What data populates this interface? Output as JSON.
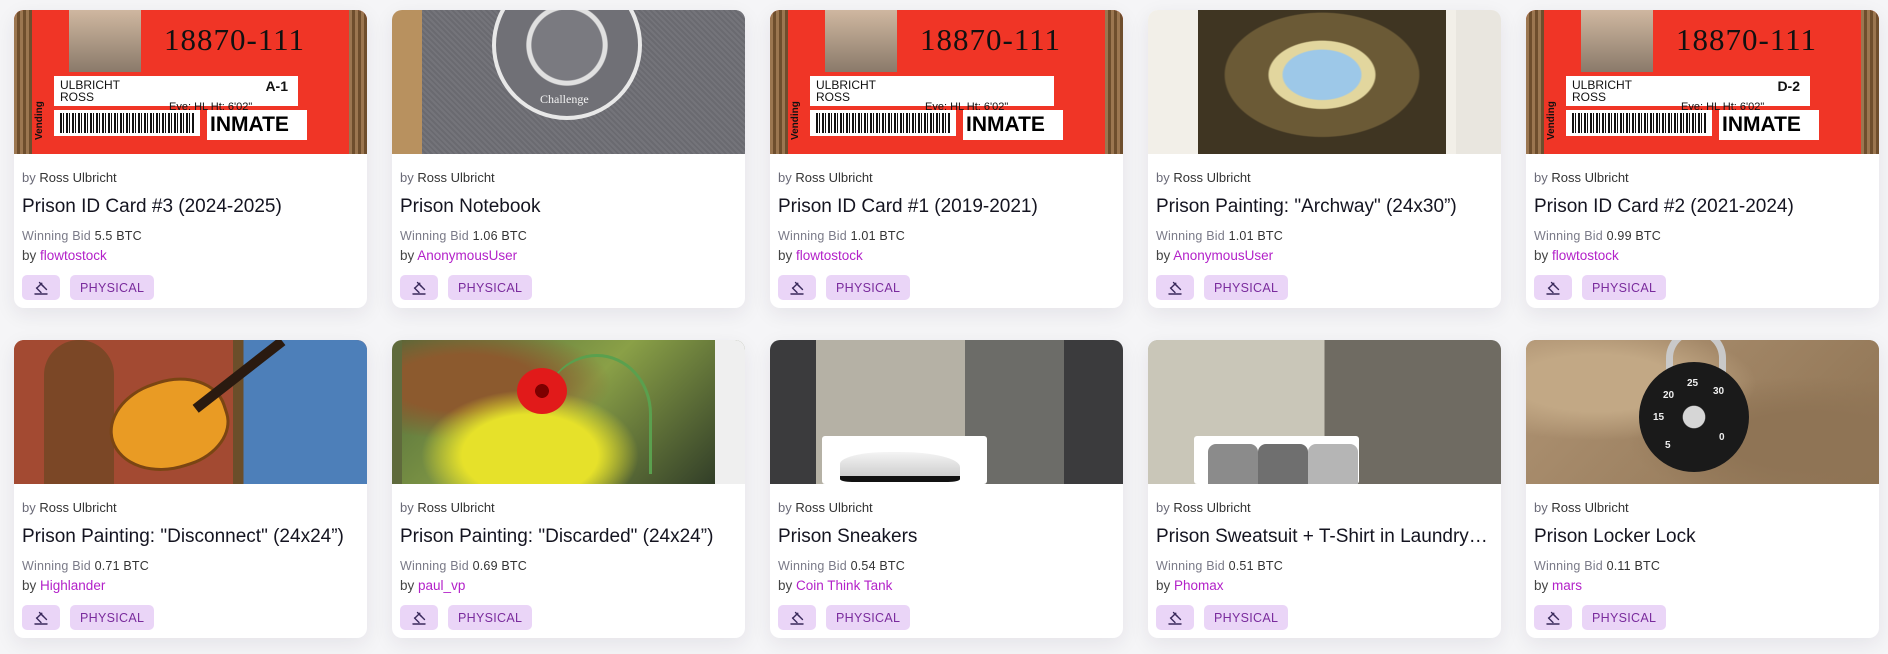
{
  "labels": {
    "by": "by",
    "winning_bid": "Winning Bid",
    "tag": "PHYSICAL"
  },
  "cards": [
    {
      "artist": "Ross Ulbricht",
      "title": "Prison ID Card #3 (2024-2025)",
      "bid": "5.5 BTC",
      "buyer": "flowtostock",
      "thumb": "id-card",
      "id_card": {
        "number": "18870-111",
        "name1": "ULBRICHT",
        "name2": "ROSS",
        "code": "A-1",
        "eye": "Eye: HL    Ht: 6'02\"",
        "inmate": "INMATE",
        "vending": "Vending"
      }
    },
    {
      "artist": "Ross Ulbricht",
      "title": "Prison Notebook",
      "bid": "1.06 BTC",
      "buyer": "AnonymousUser",
      "thumb": "notebook",
      "seal_text": "Challenge"
    },
    {
      "artist": "Ross Ulbricht",
      "title": "Prison ID Card #1 (2019-2021)",
      "bid": "1.01 BTC",
      "buyer": "flowtostock",
      "thumb": "id-card",
      "id_card": {
        "number": "18870-111",
        "name1": "ULBRICHT",
        "name2": "ROSS",
        "code": "",
        "eye": "Eye: HL    Ht: 6'02\"",
        "inmate": "INMATE",
        "vending": "Vending"
      }
    },
    {
      "artist": "Ross Ulbricht",
      "title": "Prison Painting: \"Archway\" (24x30”)",
      "bid": "1.01 BTC",
      "buyer": "AnonymousUser",
      "thumb": "arch"
    },
    {
      "artist": "Ross Ulbricht",
      "title": "Prison ID Card #2 (2021-2024)",
      "bid": "0.99 BTC",
      "buyer": "flowtostock",
      "thumb": "id-card",
      "id_card": {
        "number": "18870-111",
        "name1": "ULBRICHT",
        "name2": "ROSS",
        "code": "D-2",
        "eye": "Eye: HL    Ht: 6'02\"",
        "inmate": "INMATE",
        "vending": "Vending"
      }
    },
    {
      "artist": "Ross Ulbricht",
      "title": "Prison Painting: \"Disconnect\" (24x24”)",
      "bid": "0.71 BTC",
      "buyer": "Highlander",
      "thumb": "guitar"
    },
    {
      "artist": "Ross Ulbricht",
      "title": "Prison Painting: \"Discarded\" (24x24”)",
      "bid": "0.69 BTC",
      "buyer": "paul_vp",
      "thumb": "poppy"
    },
    {
      "artist": "Ross Ulbricht",
      "title": "Prison Sneakers",
      "bid": "0.54 BTC",
      "buyer": "Coin Think Tank",
      "thumb": "sneakers"
    },
    {
      "artist": "Ross Ulbricht",
      "title": "Prison Sweatsuit + T-Shirt in Laundry Bag",
      "bid": "0.51 BTC",
      "buyer": "Phomax",
      "thumb": "sweat"
    },
    {
      "artist": "Ross Ulbricht",
      "title": "Prison Locker Lock",
      "bid": "0.11 BTC",
      "buyer": "mars",
      "thumb": "lock",
      "dial_numbers": [
        "25",
        "30",
        "20",
        "15",
        "5",
        "0"
      ]
    }
  ],
  "colors": {
    "accent": "#b321c9",
    "tag_bg": "#ead5f7",
    "tag_text": "#7a2b9d"
  },
  "icons": {
    "tag_icon": "gavel-icon"
  }
}
